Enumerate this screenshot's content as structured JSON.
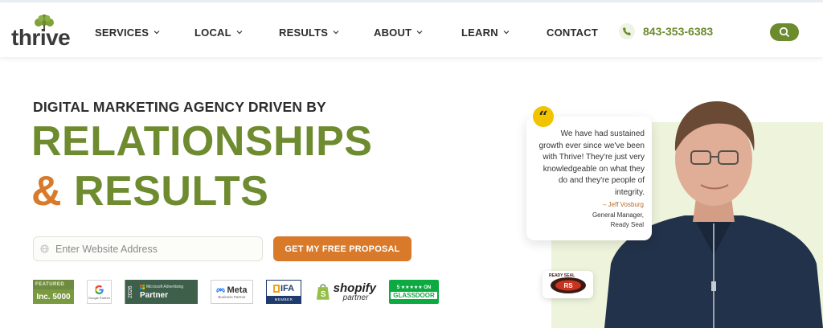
{
  "brand": {
    "name": "thrive",
    "color_green": "#6e8b30",
    "color_orange": "#d87a2a"
  },
  "nav": {
    "items": [
      {
        "label": "SERVICES",
        "has_dropdown": true
      },
      {
        "label": "LOCAL",
        "has_dropdown": true
      },
      {
        "label": "RESULTS",
        "has_dropdown": true
      },
      {
        "label": "ABOUT",
        "has_dropdown": true
      },
      {
        "label": "LEARN",
        "has_dropdown": true
      },
      {
        "label": "CONTACT",
        "has_dropdown": false
      }
    ],
    "phone": "843-353-6383",
    "icons": {
      "phone": "phone-icon",
      "search": "search-icon",
      "chevron": "chevron-down-icon"
    }
  },
  "hero": {
    "eyebrow": "DIGITAL MARKETING AGENCY DRIVEN BY",
    "headline_line1": "RELATIONSHIPS",
    "headline_amp": "&",
    "headline_line2": "RESULTS",
    "url_placeholder": "Enter Website Address",
    "cta_label": "GET MY FREE PROPOSAL"
  },
  "badges": {
    "inc_featured": "FEATURED",
    "inc_label": "Inc. 5000",
    "google_label": "Google Partner",
    "ms_year": "2026",
    "ms_small": "Microsoft Advertising",
    "ms_big": "Partner",
    "meta_label": "Meta",
    "meta_sub": "Business Partner",
    "ifa_label": "IFA",
    "ifa_sub": "MEMBER",
    "shopify_label": "shopify",
    "shopify_sub": "partner",
    "glassdoor_top": "5 ★★★★★ ON",
    "glassdoor_label": "GLASSDOOR"
  },
  "testimonial": {
    "quote_mark": "“",
    "text": "We have had sustained growth ever since we've been with Thrive! They're just very knowledgeable on what they do and they're people of integrity.",
    "author": "– Jeff Vosburg",
    "role_line1": "General Manager,",
    "role_line2": "Ready Seal",
    "company_logo": "READY SEAL"
  }
}
